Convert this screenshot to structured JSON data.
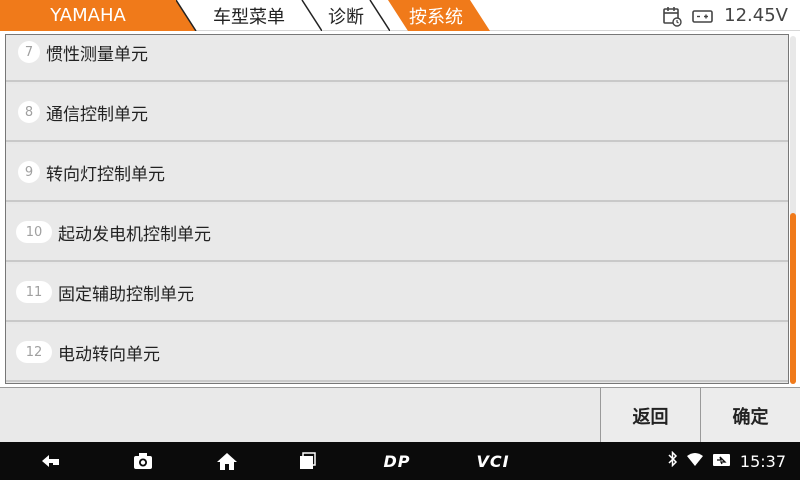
{
  "breadcrumb": {
    "brand": "YAMAHA",
    "model_menu": "车型菜单",
    "diagnosis": "诊断",
    "system": "按系统"
  },
  "status": {
    "voltage": "12.45V",
    "calendar_icon": "calendar-clock-icon",
    "battery_icon": "battery-icon"
  },
  "items": [
    {
      "num": "7",
      "label": "惯性测量单元"
    },
    {
      "num": "8",
      "label": "通信控制单元"
    },
    {
      "num": "9",
      "label": "转向灯控制单元"
    },
    {
      "num": "10",
      "label": "起动发电机控制单元"
    },
    {
      "num": "11",
      "label": "固定辅助控制单元"
    },
    {
      "num": "12",
      "label": "电动转向单元"
    }
  ],
  "actions": {
    "back": "返回",
    "ok": "确定"
  },
  "navbar": {
    "dp": "DP",
    "vci": "VCI",
    "time": "15:37"
  },
  "colors": {
    "accent": "#f07a1a",
    "row_bg": "#e9e9e9",
    "navbar_bg": "#0b0b0b"
  },
  "scroll": {
    "position_fraction": 0.51,
    "visible_fraction": 0.49
  }
}
